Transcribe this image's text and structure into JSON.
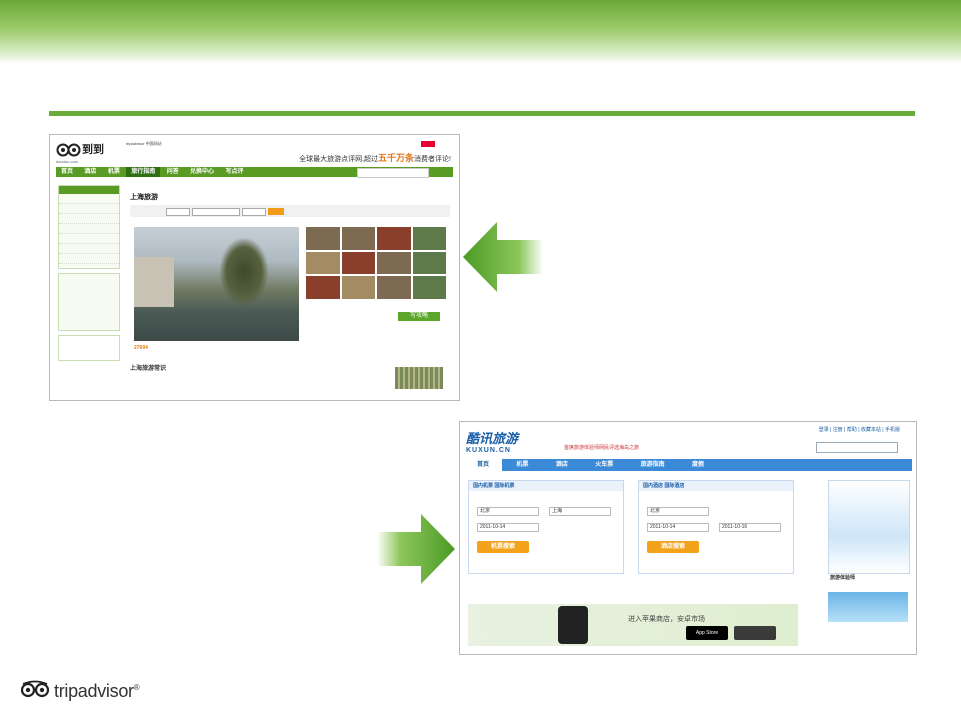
{
  "slide": {
    "brand": {
      "name": "tripadvisor",
      "trademark": "®"
    }
  },
  "daodao": {
    "logo_text": "到到",
    "logo_sub": "daodao.com",
    "partner": "tripadvisor 中国网站",
    "slogan_prefix": "全球最大旅游点评网,超过",
    "slogan_highlight": "五千万条",
    "slogan_suffix": "消费者评论!",
    "nav": [
      "首页",
      "酒店",
      "机票",
      "旅行指南",
      "问答",
      "兑换中心",
      "写点评"
    ],
    "page_title": "上海旅游",
    "photo_count": "27694",
    "strategy_button": "写攻略",
    "section_title": "上海旅游常识"
  },
  "kuxun": {
    "logo": "酷讯旅游",
    "logo_sub": "KUXUN.CN",
    "tagline": "首席旅游体验师网民评选海岛之旅",
    "top_links": "登录 | 注册 | 帮助 | 收藏本站 | 手机版",
    "nav": [
      "首页",
      "机票",
      "酒店",
      "火车票",
      "旅游指南",
      "度假"
    ],
    "flight_panel": {
      "tabs": "国内机票  国际机票",
      "from": "北京",
      "to": "上海",
      "date": "2011-10-14",
      "button": "机票搜索"
    },
    "hotel_panel": {
      "tabs": "国内酒店  国际酒店",
      "city": "北京",
      "checkin": "2011-10-14",
      "checkout": "2011-10-16",
      "button": "酒店搜索"
    },
    "promo_text": "进入苹果商店，安卓市场",
    "appstore": "App Store",
    "right_title": "旅游体验师"
  },
  "colors": {
    "brand_green": "#6aac3a",
    "kuxun_blue": "#3b8ad8",
    "kuxun_orange": "#f2a21b"
  }
}
